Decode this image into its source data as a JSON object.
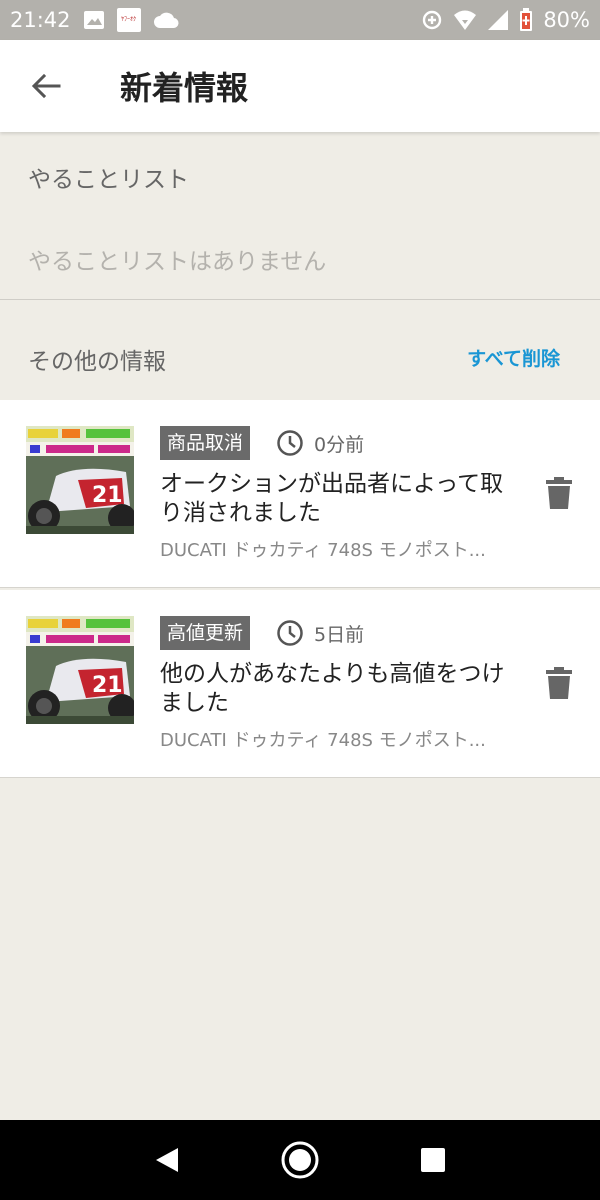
{
  "status_bar": {
    "time": "21:42",
    "battery": "80%",
    "notif_text": "ﾔﾌｰｵｸ"
  },
  "header": {
    "title": "新着情報"
  },
  "todo": {
    "title": "やることリスト",
    "empty_text": "やることリストはありません"
  },
  "other": {
    "title": "その他の情報",
    "delete_all": "すべて削除"
  },
  "notifications": [
    {
      "badge": "商品取消",
      "time": "0分前",
      "message": "オークションが出品者によって取り消されました",
      "item_title": "DUCATI ドゥカティ 748S モノポスト..."
    },
    {
      "badge": "高値更新",
      "time": "5日前",
      "message": "他の人があなたよりも高値をつけました",
      "item_title": "DUCATI ドゥカティ 748S モノポスト..."
    }
  ],
  "colors": {
    "background": "#efede6",
    "accent": "#1a96d4",
    "badge": "#6a6a6a",
    "status_bar": "#b3b1ac"
  }
}
